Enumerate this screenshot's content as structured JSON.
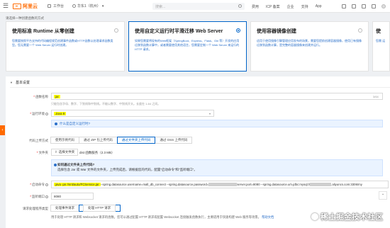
{
  "topbar": {
    "logo_text": "阿里云",
    "workbench": "工作台",
    "region": "华东1（杭州）",
    "search_placeholder": "搜索...",
    "links": [
      "费用",
      "ICP 备案",
      "企业",
      "支持",
      "App"
    ]
  },
  "subtitle": "请选择一种创建函数的方式",
  "cards": [
    {
      "title": "使用标准 Runtime 从零创建",
      "desc": "您需要按照平台支持的代码编程规范创建事件函数或HTTP函数以处理请求函数类型。您无需要一个 Web Server 运行时创建。",
      "selected": false
    },
    {
      "title": "使用自定义运行时平滑迁移 Web Server",
      "desc": "如果您需要将现有的Web框架（SpringBoot、Express、Flask、Gin 等）开发的应用迁移到函数计算中，或者需要使用其他语言，您需要定制一个 Web Server 来运行的 HTTP 请求。",
      "selected": true
    },
    {
      "title": "使用容器镜像创建",
      "desc": "适用于使用镜像引擎管理应用发布的场景，需要您提前创建容器镜像，使用已有镜像迁移到函数计算，是完整的容器镜像来创建并运行。",
      "selected": false
    },
    {
      "title": "使",
      "desc": "您需 运",
      "selected": false
    }
  ],
  "section": {
    "title": "基本设置"
  },
  "form": {
    "func_name_label": "函数名称",
    "func_name_value": "jar",
    "func_name_counter": "3/64",
    "func_name_hint": "只能包含字母、数字、下划线和中划线。不能以数字、中划线开头。长度在 1-64 之间。",
    "runtime_label": "运行环境",
    "runtime_value": "Java 8",
    "runtime_info": "什么是自定义运行时?",
    "upload_label": "代码上传方式",
    "upload_options": [
      "使用示例代码",
      "通过 ZIP 包上传代码",
      "通过文件夹上传代码",
      "通过 OSS 上传代码"
    ],
    "file_label": "文件夹",
    "file_btn": "选择文件夹",
    "file_name": "dist 函数服务（2.3 MB）",
    "notice_title": "如何通过文件夹上传代码?",
    "notice_body": "选择包含 Jar 或 War 文件的文件夹，上传完成后，请根据您的代码，配置\"启动命令\"和\"监听端口\"。",
    "start_cmd_label": "启动命令",
    "start_cmd_hl": "java -jar /mnt/auto/FCService.jar",
    "start_cmd_rest": "--spring.datasource.username=mall_db_connect --spring.datasource.password=",
    "start_cmd_tail": "server.port=8080 --spring.datasource.url=jdbc:mysql://",
    "start_cmd_end": ".aliyuncs.com:3306/my",
    "port_label": "监听端口",
    "port_value": "8080",
    "request_type_label": "请求处理程序类型",
    "request_type_options": [
      "处理事件请求",
      "处理 HTTP 请求"
    ],
    "footer_note": "用于处理 HTTP 请求和 Websocket 请求的函数。您可以通过配置 HTTP 请求或配置 Websocket 连接触发函数执行，主要适用于快速构建 Web 服务等场景。",
    "footer_link": "帮助文档"
  },
  "watermark": "稀土掘金技术社区",
  "colors": {
    "brand": "#ff6a00",
    "accent": "#0064c8",
    "highlight": "#ffff00"
  }
}
